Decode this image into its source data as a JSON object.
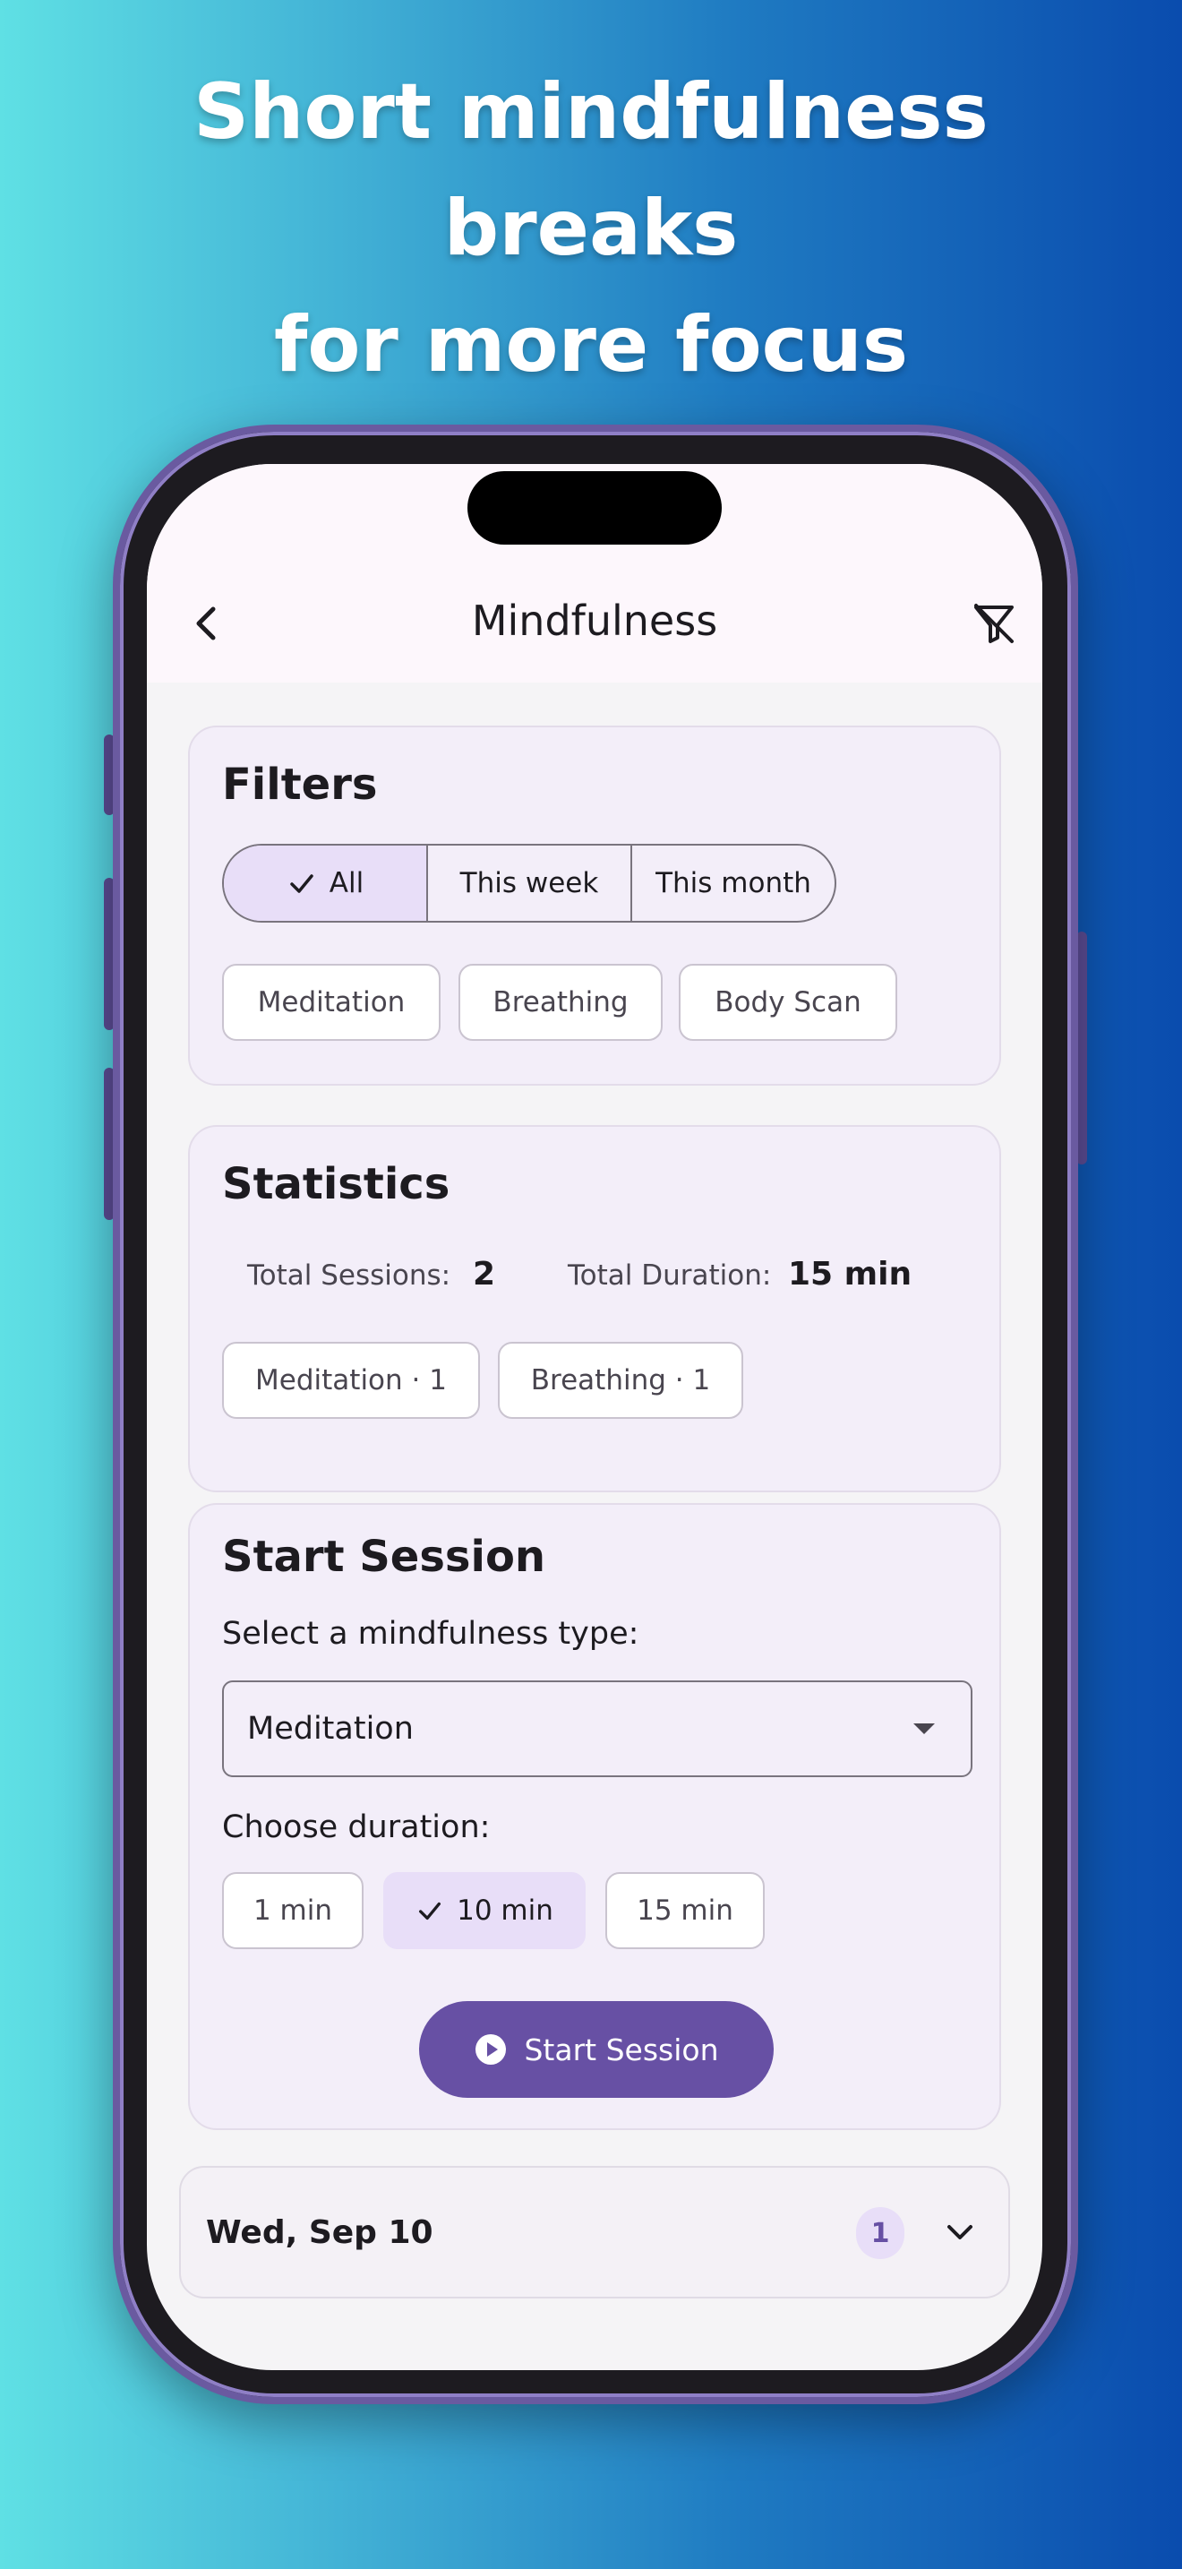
{
  "headline": {
    "line1": "Short mindfulness",
    "line2": "breaks",
    "line3": "for more focus"
  },
  "appbar": {
    "title": "Mindfulness",
    "back_icon": "chevron-left-icon",
    "clear_filter_icon": "filter-off-icon"
  },
  "filters": {
    "title": "Filters",
    "period_options": [
      "All",
      "This week",
      "This month"
    ],
    "selected_period": "All",
    "type_chips": [
      "Meditation",
      "Breathing",
      "Body Scan"
    ]
  },
  "statistics": {
    "title": "Statistics",
    "total_sessions_label": "Total Sessions:",
    "total_sessions_value": "2",
    "total_duration_label": "Total Duration:",
    "total_duration_value": "15 min",
    "breakdown": [
      "Meditation · 1",
      "Breathing · 1"
    ]
  },
  "start_session": {
    "title": "Start Session",
    "type_label": "Select a mindfulness type:",
    "type_value": "Meditation",
    "duration_label": "Choose duration:",
    "durations": [
      "1 min",
      "10 min",
      "15 min"
    ],
    "selected_duration": "10 min",
    "button_label": "Start Session",
    "button_icon": "play-circle-icon"
  },
  "history": {
    "date": "Wed, Sep 10",
    "count": "1"
  },
  "colors": {
    "primary": "#6750a4",
    "selected_chip": "#e8def8",
    "card_bg": "#f3eef9"
  }
}
